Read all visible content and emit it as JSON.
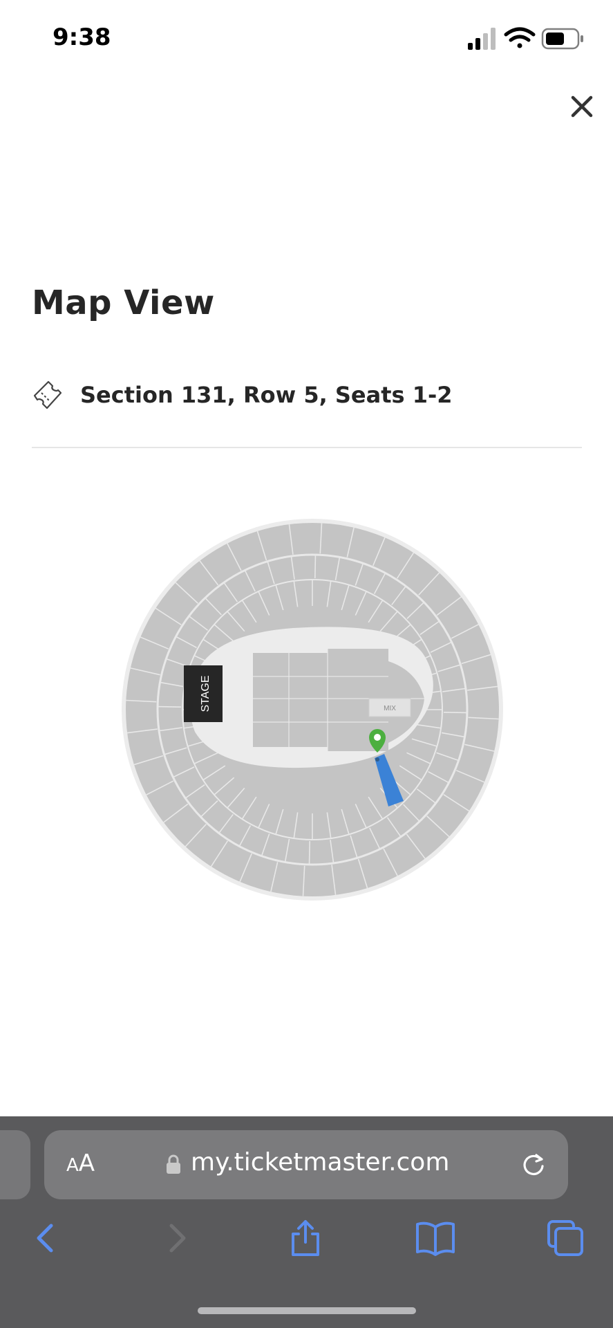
{
  "status_bar": {
    "time": "9:38"
  },
  "modal": {
    "title": "Map View",
    "seat_info": "Section 131, Row 5, Seats 1-2"
  },
  "venue_map": {
    "stage_label": "STAGE",
    "mix_label": "MIX",
    "highlighted_section": "131",
    "colors": {
      "section": "#c4c4c4",
      "floor": "#f1f1f1",
      "highlight": "#3b82d6",
      "pin": "#4caf3f",
      "stage": "#262626"
    }
  },
  "browser": {
    "text_size_label": "AA",
    "url": "my.ticketmaster.com",
    "toolbar": [
      "back-icon",
      "forward-icon",
      "share-icon",
      "bookmarks-icon",
      "tabs-icon"
    ],
    "accent": "#5b8def"
  }
}
